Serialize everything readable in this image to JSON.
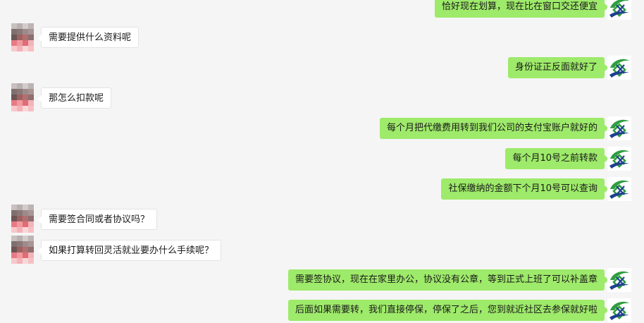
{
  "colors": {
    "background": "#f5f5f5",
    "sent_bubble": "#9eea6a",
    "received_bubble": "#ffffff",
    "logo_green": "#2f9e3f",
    "logo_blue": "#1d3f8f"
  },
  "contact_avatar_icon": "pixelated-avatar-icon",
  "self_avatar_icon": "company-logo-icon",
  "messages": [
    {
      "side": "right",
      "text": "恰好现在划算，现在比在窗口交还便宜"
    },
    {
      "side": "left",
      "text": "需要提供什么资料呢"
    },
    {
      "side": "right",
      "text": "身份证正反面就好了"
    },
    {
      "side": "left",
      "text": "那怎么扣款呢"
    },
    {
      "side": "right",
      "text": "每个月把代缴费用转到我们公司的支付宝账户就好的"
    },
    {
      "side": "right",
      "text": "每个月10号之前转款"
    },
    {
      "side": "right",
      "text": "社保缴纳的金额下个月10号可以查询"
    },
    {
      "side": "left",
      "text": "需要签合同或者协议吗？"
    },
    {
      "side": "left",
      "text": "如果打算转回灵活就业要办什么手续呢？"
    },
    {
      "side": "right",
      "text": "需要签协议，现在在家里办公，协议没有公章，等到正式上班了可以补盖章"
    },
    {
      "side": "right",
      "text": "后面如果需要转，我们直接停保，停保了之后，您到就近社区去参保就好啦"
    }
  ]
}
